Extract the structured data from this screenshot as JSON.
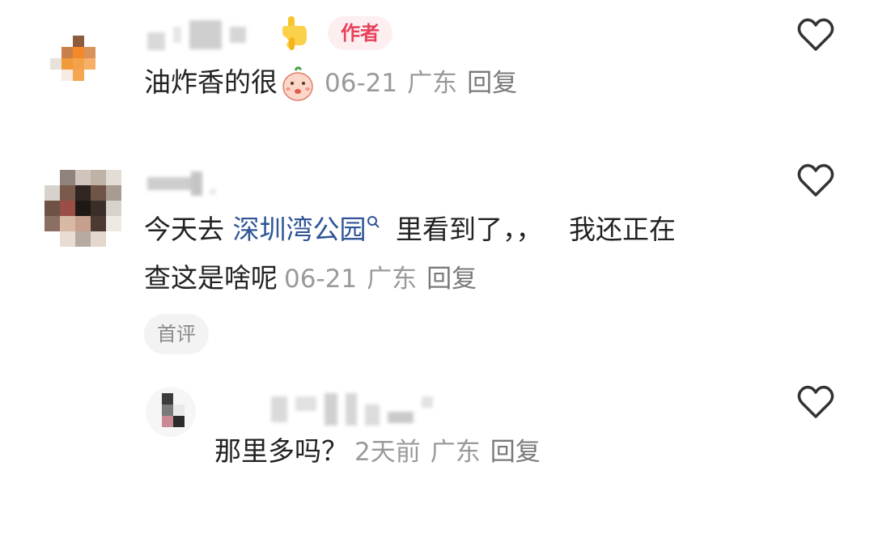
{
  "comments": [
    {
      "author_badge": "作者",
      "text": "油炸香的很",
      "date": "06-21",
      "location": "广东",
      "reply_label": "回复",
      "emoji": "pouting-face-emoji",
      "pointing_emoji": "backhand-index-pointing-down-emoji"
    },
    {
      "text_part1": "今天去",
      "link_text": "深圳湾公园",
      "text_part2": "里看到了，，",
      "text_part3": "我还正在",
      "text_line2": "查这是啥呢",
      "date": "06-21",
      "location": "广东",
      "reply_label": "回复",
      "tag": "首评"
    }
  ],
  "reply": {
    "text": "那里多吗？",
    "date": "2天前",
    "location": "广东",
    "reply_label": "回复"
  },
  "colors": {
    "author_badge_bg": "#fdeef0",
    "author_badge_text": "#e8415c",
    "link": "#2f5597",
    "meta": "#9a9a9a"
  },
  "icons": [
    "heart-outline-icon",
    "search-icon"
  ]
}
